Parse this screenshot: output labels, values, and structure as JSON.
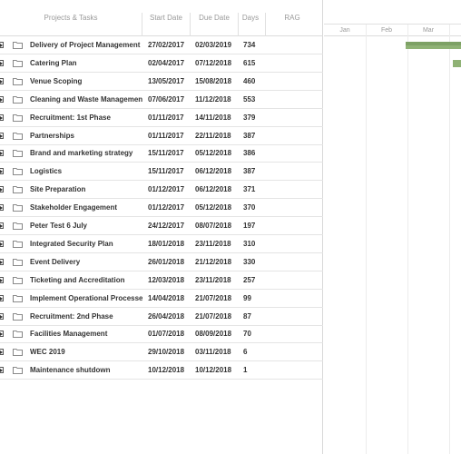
{
  "columns": {
    "task": "Projects & Tasks",
    "start": "Start Date",
    "due": "Due Date",
    "days": "Days",
    "rag": "RAG"
  },
  "timeline": {
    "months": [
      "Jan",
      "Feb",
      "Mar"
    ]
  },
  "rows": [
    {
      "name": "Delivery of Project Management S",
      "start": "27/02/2017",
      "due": "02/03/2019",
      "days": "734"
    },
    {
      "name": "Catering Plan",
      "start": "02/04/2017",
      "due": "07/12/2018",
      "days": "615"
    },
    {
      "name": "Venue Scoping",
      "start": "13/05/2017",
      "due": "15/08/2018",
      "days": "460"
    },
    {
      "name": "Cleaning and Waste Managemen",
      "start": "07/06/2017",
      "due": "11/12/2018",
      "days": "553"
    },
    {
      "name": "Recruitment: 1st Phase",
      "start": "01/11/2017",
      "due": "14/11/2018",
      "days": "379"
    },
    {
      "name": "Partnerships",
      "start": "01/11/2017",
      "due": "22/11/2018",
      "days": "387"
    },
    {
      "name": "Brand and marketing strategy",
      "start": "15/11/2017",
      "due": "05/12/2018",
      "days": "386"
    },
    {
      "name": "Logistics",
      "start": "15/11/2017",
      "due": "06/12/2018",
      "days": "387"
    },
    {
      "name": "Site Preparation",
      "start": "01/12/2017",
      "due": "06/12/2018",
      "days": "371"
    },
    {
      "name": "Stakeholder Engagement",
      "start": "01/12/2017",
      "due": "05/12/2018",
      "days": "370"
    },
    {
      "name": "Peter Test 6 July",
      "start": "24/12/2017",
      "due": "08/07/2018",
      "days": "197"
    },
    {
      "name": "Integrated Security Plan",
      "start": "18/01/2018",
      "due": "23/11/2018",
      "days": "310"
    },
    {
      "name": "Event Delivery",
      "start": "26/01/2018",
      "due": "21/12/2018",
      "days": "330"
    },
    {
      "name": "Ticketing and Accreditation",
      "start": "12/03/2018",
      "due": "23/11/2018",
      "days": "257"
    },
    {
      "name": "Implement Operational Processe",
      "start": "14/04/2018",
      "due": "21/07/2018",
      "days": "99"
    },
    {
      "name": "Recruitment: 2nd Phase",
      "start": "26/04/2018",
      "due": "21/07/2018",
      "days": "87"
    },
    {
      "name": "Facilities Management",
      "start": "01/07/2018",
      "due": "08/09/2018",
      "days": "70"
    },
    {
      "name": "WEC 2019",
      "start": "29/10/2018",
      "due": "03/11/2018",
      "days": "6"
    },
    {
      "name": "Maintenance shutdown",
      "start": "10/12/2018",
      "due": "10/12/2018",
      "days": "1"
    }
  ],
  "colors": {
    "bar": "#8fb275",
    "bar_head": "#7da165",
    "grid_line": "#e4e4e4"
  },
  "icons": [
    "expand-icon",
    "folder-icon"
  ]
}
